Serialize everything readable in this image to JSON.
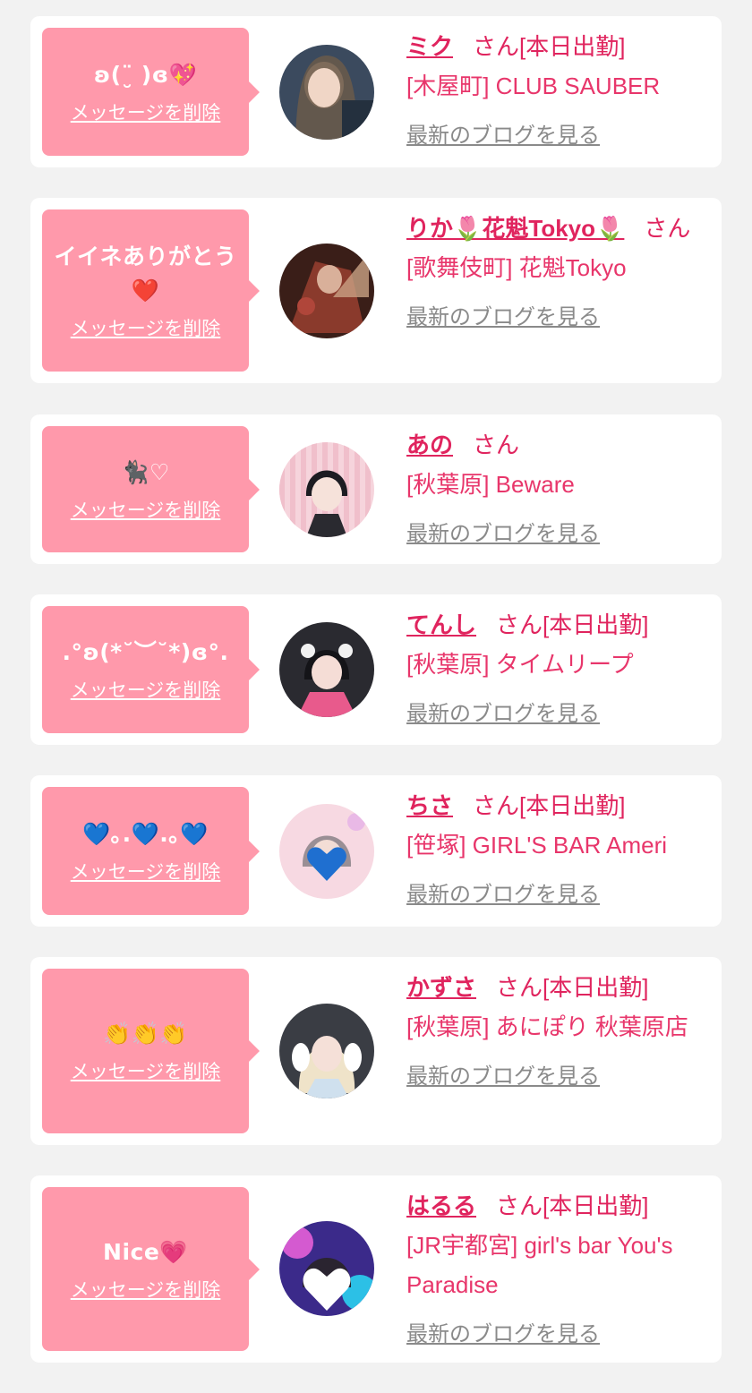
{
  "delete_label": "メッセージを削除",
  "blog_label": "最新のブログを見る",
  "san_suffix": "さん",
  "cards": [
    {
      "message": "ʚ(¨̮ )ɞ💖",
      "name": "ミク",
      "status": "[本日出勤]",
      "shop": "[木屋町] CLUB SAUBER"
    },
    {
      "message": "イイネありがとう❤️",
      "name": "りか🌷花魁Tokyo🌷",
      "status": "",
      "shop": "[歌舞伎町] 花魁Tokyo"
    },
    {
      "message": "🐈‍⬛♡",
      "name": "あの",
      "status": "",
      "shop": "[秋葉原] Beware"
    },
    {
      "message": ".°ʚ(*˘︶˘*)ɞ°.",
      "name": "てんし",
      "status": "[本日出勤]",
      "shop": "[秋葉原] タイムリープ"
    },
    {
      "message": "💙｡.💙.｡💙",
      "name": "ちさ",
      "status": "[本日出勤]",
      "shop": "[笹塚] GIRL'S BAR Ameri"
    },
    {
      "message": "👏👏👏",
      "name": "かずさ",
      "status": "[本日出勤]",
      "shop": "[秋葉原] あにぽり 秋葉原店"
    },
    {
      "message": "Nice💗",
      "name": "はるる",
      "status": "[本日出勤]",
      "shop": "[JR宇都宮] girl's bar You's Paradise"
    }
  ],
  "colors": {
    "background": "#f2f2f2",
    "card": "#ffffff",
    "bubble": "#ff99ab",
    "name": "#e0245e",
    "shop": "#e8366b",
    "blog_link": "#8a8a8a"
  },
  "icons": [
    "avatar-photo",
    "bubble-tail"
  ]
}
